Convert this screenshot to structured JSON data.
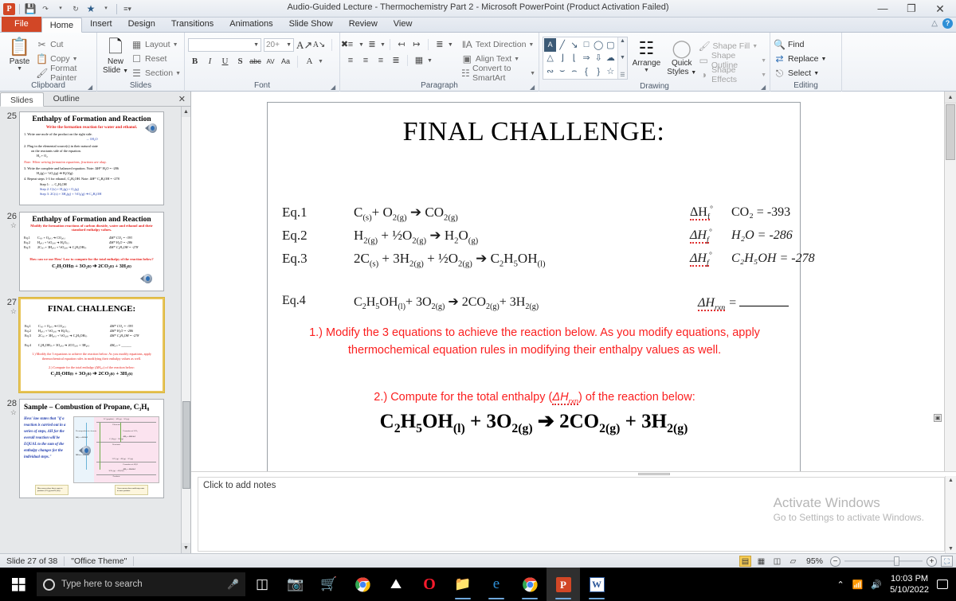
{
  "window": {
    "title": "Audio-Guided Lecture - Thermochemistry Part 2  -  Microsoft PowerPoint (Product Activation Failed)",
    "app_logo": "P",
    "quick_access": [
      "save-icon",
      "undo-icon",
      "redo-icon",
      "star-icon",
      "customize-qat-icon"
    ],
    "controls": {
      "minimize": "—",
      "restore": "❐",
      "close": "✕"
    },
    "help": {
      "ribbon_collapse": "△",
      "help_label": "?"
    }
  },
  "ribbon": {
    "tabs": [
      {
        "label": "File",
        "kind": "file"
      },
      {
        "label": "Home",
        "kind": "active"
      },
      {
        "label": "Insert",
        "kind": "normal"
      },
      {
        "label": "Design",
        "kind": "normal"
      },
      {
        "label": "Transitions",
        "kind": "normal"
      },
      {
        "label": "Animations",
        "kind": "normal"
      },
      {
        "label": "Slide Show",
        "kind": "normal"
      },
      {
        "label": "Review",
        "kind": "normal"
      },
      {
        "label": "View",
        "kind": "normal"
      }
    ],
    "clipboard": {
      "group_label": "Clipboard",
      "paste": "Paste",
      "cut": "Cut",
      "copy": "Copy",
      "format_painter": "Format Painter"
    },
    "slides": {
      "group_label": "Slides",
      "new_slide": "New\nSlide",
      "new_slide_line1": "New",
      "new_slide_line2": "Slide",
      "layout": "Layout",
      "reset": "Reset",
      "section": "Section"
    },
    "font": {
      "group_label": "Font",
      "font_name": "",
      "font_size": "20+",
      "grow": "A",
      "shrink": "A",
      "clear_formatting": "clear-formatting-icon",
      "bold": "B",
      "italic": "I",
      "underline": "U",
      "shadow": "S",
      "strikethrough": "abc",
      "spacing": "AV",
      "change_case": "Aa",
      "font_color": "A"
    },
    "paragraph": {
      "group_label": "Paragraph",
      "text_direction": "Text Direction",
      "align_text": "Align Text",
      "convert_smartart": "Convert to SmartArt"
    },
    "drawing": {
      "group_label": "Drawing",
      "arrange": "Arrange",
      "quick_styles_l1": "Quick",
      "quick_styles_l2": "Styles",
      "shape_fill": "Shape Fill",
      "shape_outline": "Shape Outline",
      "shape_effects": "Shape Effects"
    },
    "editing": {
      "group_label": "Editing",
      "find": "Find",
      "replace": "Replace",
      "select": "Select"
    }
  },
  "slide_panel": {
    "tabs": [
      {
        "label": "Slides",
        "active": true
      },
      {
        "label": "Outline",
        "active": false
      }
    ],
    "close": "✕",
    "thumbnails": [
      {
        "number": "25",
        "selected": false,
        "has_animation": false,
        "title": "Enthalpy  of Formation  and  Reaction",
        "subtitle": "Write the formation reaction for water and ethanol.",
        "lines": [
          "1.   Write one mole of the product on the right side.",
          "→  1H₂O",
          "2.   Plug in the elemental source(s) in their natural state",
          "on the reactants side of the equation.",
          "H₂ + O₂",
          "Note: When writing formation equations, fractions are okay.",
          "3.   Write the complete and balanced equation.  Note: ΔHᶠ°   H₂O = -286",
          "H₂(g) + ½O₂(g) ➔  H₂O(g)",
          "4.   Repeat steps 1-3  for ethanol, C₂H₅OH.        Note: ΔHᶠ°  C₂H₅OH = -278",
          "Step 1:                                     → C₂H₅OH",
          "Step 2:    C(s) + H₂(g) + O₂(g)",
          "Step 3:   2C(s) + 3H₂(g) + ½O₂(g) ➔ C₂H₅OH"
        ]
      },
      {
        "number": "26",
        "selected": false,
        "has_animation": true,
        "title": "Enthalpy  of Formation  and  Reaction",
        "subtitle": "Modify the formation reactions of carbon dioxide, water and ethanol and their standard enthalpy values.",
        "eqs": [
          {
            "label": "Eq.1",
            "body": "C₍ₛ₎ + O₂₍ₜ₎ ➔ CO₂₍ₜ₎",
            "dh": "ΔHᶠ°  CO₂ = -393"
          },
          {
            "label": "Eq.2",
            "body": "H₂₍ₜ₎ + ½O₂₍ₜ₎ ➔ H₂O₍ₜ₎",
            "dh": "ΔHᶠ°  H₂O = -286"
          },
          {
            "label": "Eq.3",
            "body": "2C₍ₛ₎ + 3H₂₍ₜ₎ + ½O₂₍ₜ₎ ➔ C₂H₅OH₍ₗ₎",
            "dh": "ΔHᶠ°  C₂H₅OH = -278"
          }
        ],
        "question": "How can we use Hess' Law to compute for the total enthalpy of the reaction below?",
        "reaction": "C₂H₅OH₍ₗ₎ + 3O₂₍ₜ₎ ➔ 2CO₂₍ₜ₎ + 3H₂₍ₜ₎"
      },
      {
        "number": "27",
        "selected": true,
        "has_animation": true,
        "title": "FINAL CHALLENGE:",
        "eqs": [
          {
            "label": "Eq.1",
            "body": "C₍ₛ₎ + O₂₍ₜ₎ ➔ CO₂₍ₜ₎",
            "dh": "ΔHᶠ°  CO₂ = -393"
          },
          {
            "label": "Eq.2",
            "body": "H₂₍ₜ₎ + ½O₂₍ₜ₎ ➔ H₂O₍ₜ₎",
            "dh": "ΔHᶠ°  H₂O = -286"
          },
          {
            "label": "Eq.3",
            "body": "2C₍ₛ₎ + 3H₂₍ₜ₎ + ½O₂₍ₜ₎ ➔ C₂H₅OH₍ₗ₎",
            "dh": "ΔHᶠ°  C₂H₅OH = -278"
          },
          {
            "label": "Eq.4",
            "body": "C₂H₅OH₍ₗ₎ + 3O₂₍ₜ₎ ➔ 2CO₂₍ₜ₎ + 3H₂₍ₜ₎",
            "dh": "ΔHᵣₓₙ = ______"
          }
        ],
        "q1": "1.) Modify the 3 equations to achieve the reaction below. As you modify equations, apply thermochemical equation rules in modifying their enthalpy values as well.",
        "q2": "2.) Compute for the total enthalpy (ΔHᵣₓₙ) of the reaction below:",
        "reaction": "C₂H₅OH₍ₗ₎ + 3O₂₍ₜ₎ ➔ 2CO₂₍ₜ₎ + 3H₂₍ₜ₎"
      },
      {
        "number": "28",
        "selected": false,
        "has_animation": true,
        "title": "Sample – Combustion of Propane, C₃H₈",
        "quote": "Hess' law states that \"if a reaction is carried out in a series of steps, ΔH for the overall reaction will be EQUAL to the sum of the enthalpy changes for the individual steps.\"",
        "diagram_labels": [
          "3C (graphite) + 4H₂(g) + 5O₂(g)",
          "Elements",
          "Decomposition to elements",
          "ΔH₁ = +103 kJ",
          "Formation of 3CO₂",
          "ΔH₂ = -1181 kJ",
          "C₃H₈(g) + 5O₂(g)",
          "Reactants",
          "3CO₂(g) + 4H₂(g) + 2O₂(g)",
          "Formation of 4H₂O",
          "ΔH₃ = -1144 kJ",
          "ΔHᵣₓₙ = -2220 kJ",
          "3CO₂(g) + 4H₂O(l)",
          "Products",
          "Blue arrows show direct route to products (CO₂(g) and H₂O(l))",
          "Green arrows show multi-step route to same products."
        ]
      }
    ]
  },
  "slide": {
    "title": "FINAL CHALLENGE:",
    "equations": [
      {
        "label": "Eq.1",
        "formula_html": "C<sub>(s)</sub>+ O<sub>2(g)</sub> ➔ CO<sub>2(g)</sub>"
      },
      {
        "label": "Eq.2",
        "formula_html": "H<sub>2(g)</sub> + ½O<sub>2(g)</sub> ➔ H<sub>2</sub>O<sub>(g)</sub>"
      },
      {
        "label": "Eq.3",
        "formula_html": "2C<sub>(s)</sub> + 3H<sub>2(g)</sub> + ½O<sub>2(g)</sub> ➔ C<sub>2</sub>H<sub>5</sub>OH<sub>(l)</sub>"
      }
    ],
    "enthalpies": [
      {
        "symbol": "ΔH",
        "sub": "f",
        "deg": "°",
        "value": "CO₂ = -393",
        "italic": false
      },
      {
        "symbol": "ΔH",
        "sub": "f",
        "deg": "°",
        "value": "H₂O = -286",
        "italic": true
      },
      {
        "symbol": "ΔH",
        "sub": "f",
        "deg": "°",
        "value": "C₂H₅OH = -278",
        "italic": true
      }
    ],
    "eq4": {
      "label": "Eq.4",
      "formula_html": "C<sub>2</sub>H<sub>5</sub>OH<sub>(l)</sub>+ 3O<sub>2(g)</sub> ➔ 2CO<sub>2(g)</sub>+ 3H<sub>2(g)</sub>",
      "dh_label": "ΔH",
      "dh_sub": "rxn",
      "dh_equals": "="
    },
    "question1": "1.) Modify the 3 equations to achieve the reaction below. As you modify equations, apply thermochemical equation rules in modifying their enthalpy values as well.",
    "question2_pre": "2.) Compute for the total enthalpy (",
    "question2_sym": "ΔH",
    "question2_sub": "rxn",
    "question2_post": ") of the reaction below:",
    "final_reaction_html": "C<sub>2</sub>H<sub>5</sub>OH<sub>(l)</sub> + 3O<sub>2(g)</sub> ➔ 2CO<sub>2(g)</sub> + 3H<sub>2(g)</sub>"
  },
  "notes": {
    "placeholder": "Click to add notes"
  },
  "watermark": {
    "line1": "Activate Windows",
    "line2": "Go to Settings to activate Windows."
  },
  "status_bar": {
    "slide_indicator": "Slide 27 of 38",
    "theme": "\"Office Theme\"",
    "views": [
      "normal-view-icon",
      "slide-sorter-icon",
      "reading-view-icon",
      "slide-show-icon"
    ],
    "zoom_out": "−",
    "zoom_level": "95%",
    "zoom_in": "+",
    "fit_to_window": "fit-slide-icon"
  },
  "taskbar": {
    "start": "start-icon",
    "search_placeholder": "Type here to search",
    "mic": "microphone-icon",
    "icons": [
      "task-view-icon",
      "camera-icon",
      "microsoft-store-icon",
      "chrome-icon",
      "photos-icon",
      "opera-icon",
      "file-explorer-icon",
      "edge-icon",
      "chrome-profile-icon",
      "powerpoint-icon",
      "word-icon"
    ],
    "tray": {
      "show_hidden": "⌃",
      "network": "network-icon",
      "volume": "volume-icon",
      "time": "10:03 PM",
      "date": "5/10/2022",
      "action_center": "action-center-icon"
    }
  },
  "colors": {
    "accent": "#d24726",
    "red_text": "#fb2020",
    "selected_thumb": "#e8c457"
  }
}
